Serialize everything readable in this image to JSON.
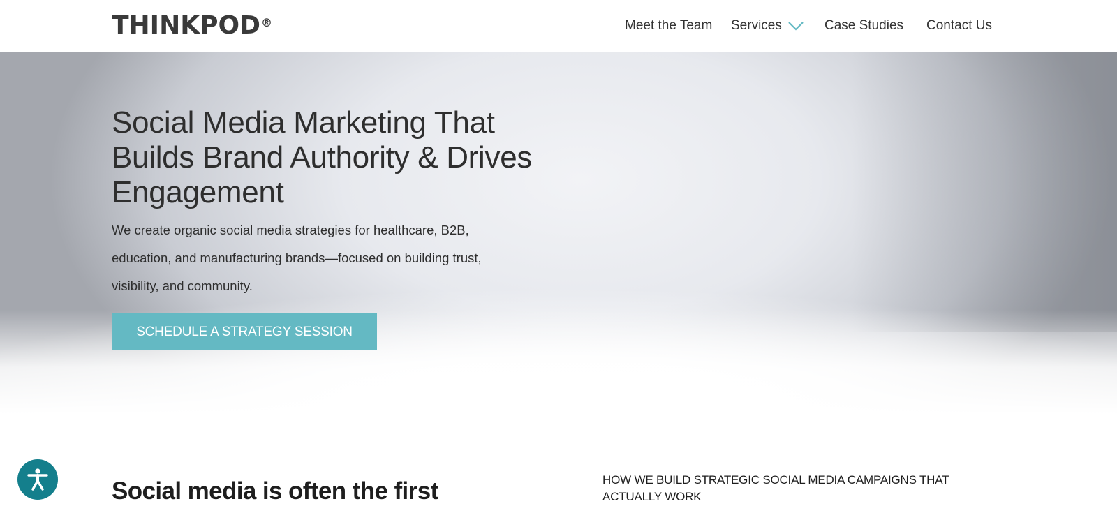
{
  "header": {
    "logo": "THINKPOD",
    "logo_mark": "®",
    "nav": {
      "meet_team": "Meet the Team",
      "services": "Services",
      "case_studies": "Case Studies",
      "contact": "Contact Us"
    },
    "services_icon": "chevron-down-icon",
    "accent_color": "#64b9c3"
  },
  "hero": {
    "title": "Social Media Marketing That Builds Brand Authority & Drives Engagement",
    "subtitle": "We create organic social media strategies for healthcare, B2B, education, and manufacturing brands—focused on building trust, visibility, and community.",
    "cta_label": "SCHEDULE A STRATEGY SESSION",
    "cta_color": "#64b9c3"
  },
  "section": {
    "heading": "Social media is often the first",
    "kicker": "HOW WE BUILD STRATEGIC SOCIAL MEDIA CAMPAIGNS THAT ACTUALLY WORK"
  },
  "accessibility": {
    "icon": "accessibility-icon",
    "color": "#147f8c"
  }
}
